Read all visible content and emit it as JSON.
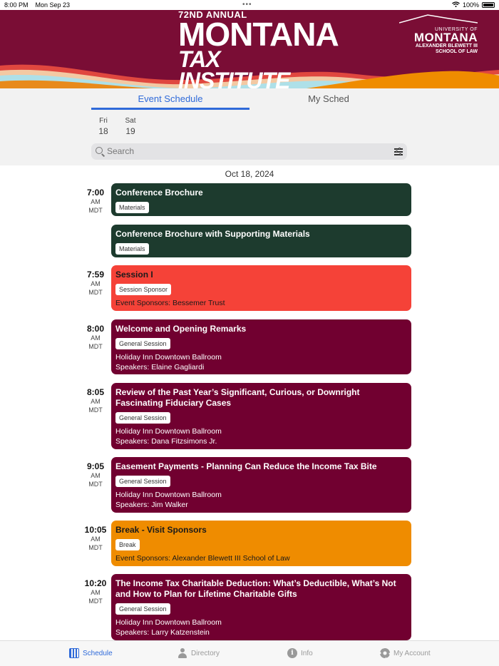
{
  "status_bar": {
    "time": "8:00 PM",
    "date": "Mon Sep 23",
    "dots": "•••",
    "battery": "100%"
  },
  "banner": {
    "edition": "72ND ANNUAL",
    "title_line1": "MONTANA",
    "title_line2": "TAX INSTITUTE",
    "logo_line1": "UNIVERSITY OF",
    "logo_line2": "MONTANA",
    "logo_line3": "ALEXANDER BLEWETT III",
    "logo_line4": "SCHOOL OF LAW"
  },
  "tabs": {
    "event_schedule": "Event Schedule",
    "my_sched": "My Sched"
  },
  "days": [
    {
      "dow": "Fri",
      "num": "18"
    },
    {
      "dow": "Sat",
      "num": "19"
    }
  ],
  "search": {
    "placeholder": "Search"
  },
  "date_header": "Oct 18, 2024",
  "events": [
    {
      "time": "7:00",
      "ampm": "AM",
      "tz": "MDT",
      "title": "Conference Brochure",
      "tag": "Materials",
      "lines": []
    },
    {
      "time": "",
      "ampm": "",
      "tz": "",
      "title": "Conference Brochure with Supporting Materials",
      "tag": "Materials",
      "lines": []
    },
    {
      "time": "7:59",
      "ampm": "AM",
      "tz": "MDT",
      "title": "Session I",
      "tag": "Session Sponsor",
      "lines": [
        "Event Sponsors: Bessemer Trust"
      ]
    },
    {
      "time": "8:00",
      "ampm": "AM",
      "tz": "MDT",
      "title": "Welcome and Opening Remarks",
      "tag": "General Session",
      "lines": [
        "Holiday Inn Downtown Ballroom",
        "Speakers: Elaine Gagliardi"
      ]
    },
    {
      "time": "8:05",
      "ampm": "AM",
      "tz": "MDT",
      "title": "Review of the Past Year’s Significant, Curious, or Downright Fascinating Fiduciary Cases",
      "tag": "General Session",
      "lines": [
        "Holiday Inn Downtown Ballroom",
        "Speakers: Dana Fitzsimons Jr."
      ]
    },
    {
      "time": "9:05",
      "ampm": "AM",
      "tz": "MDT",
      "title": "Easement Payments - Planning Can Reduce the Income Tax Bite",
      "tag": "General Session",
      "lines": [
        "Holiday Inn Downtown Ballroom",
        "Speakers: Jim Walker"
      ]
    },
    {
      "time": "10:05",
      "ampm": "AM",
      "tz": "MDT",
      "title": "Break - Visit Sponsors",
      "tag": "Break",
      "lines": [
        "Event Sponsors: Alexander Blewett III School of Law"
      ]
    },
    {
      "time": "10:20",
      "ampm": "AM",
      "tz": "MDT",
      "title": "The Income Tax Charitable Deduction:  What’s Deductible, What’s Not and How to Plan for Lifetime Charitable Gifts",
      "tag": "General Session",
      "lines": [
        "Holiday Inn Downtown Ballroom",
        "Speakers: Larry Katzenstein"
      ]
    }
  ],
  "colors": {
    "green": "#1d3b2e",
    "red": "#f54238",
    "maroon": "#710030",
    "orange": "#ef8c00",
    "accent": "#2f6ad9"
  },
  "tabbar": {
    "schedule": "Schedule",
    "directory": "Directory",
    "info": "Info",
    "account": "My Account"
  }
}
